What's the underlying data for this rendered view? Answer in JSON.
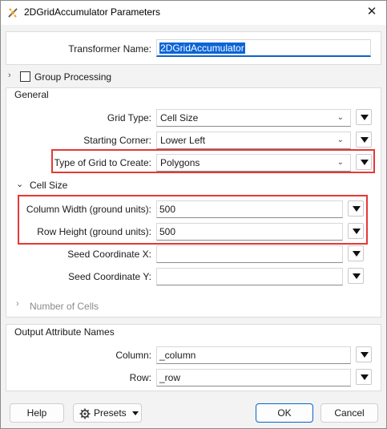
{
  "window": {
    "title": "2DGridAccumulator Parameters",
    "close_icon": "✕"
  },
  "transformer": {
    "label": "Transformer Name:",
    "value": "2DGridAccumulator"
  },
  "group_processing": {
    "label": "Group Processing",
    "checked": false
  },
  "general": {
    "title": "General",
    "grid_type": {
      "label": "Grid Type:",
      "value": "Cell Size"
    },
    "starting_corner": {
      "label": "Starting Corner:",
      "value": "Lower Left"
    },
    "type_of_grid": {
      "label": "Type of Grid to Create:",
      "value": "Polygons"
    }
  },
  "cell_size": {
    "title": "Cell Size",
    "column_width": {
      "label": "Column Width (ground units):",
      "value": "500"
    },
    "row_height": {
      "label": "Row Height (ground units):",
      "value": "500"
    },
    "seed_x": {
      "label": "Seed Coordinate X:",
      "value": ""
    },
    "seed_y": {
      "label": "Seed Coordinate Y:",
      "value": ""
    }
  },
  "number_of_cells": {
    "title": "Number of Cells"
  },
  "output": {
    "title": "Output Attribute Names",
    "column": {
      "label": "Column:",
      "value": "_column"
    },
    "row": {
      "label": "Row:",
      "value": "_row"
    }
  },
  "buttons": {
    "help": "Help",
    "presets": "Presets",
    "ok": "OK",
    "cancel": "Cancel"
  },
  "colors": {
    "highlight": "#e53935",
    "selection": "#0a64d6",
    "ok_border": "#0a64c8"
  }
}
